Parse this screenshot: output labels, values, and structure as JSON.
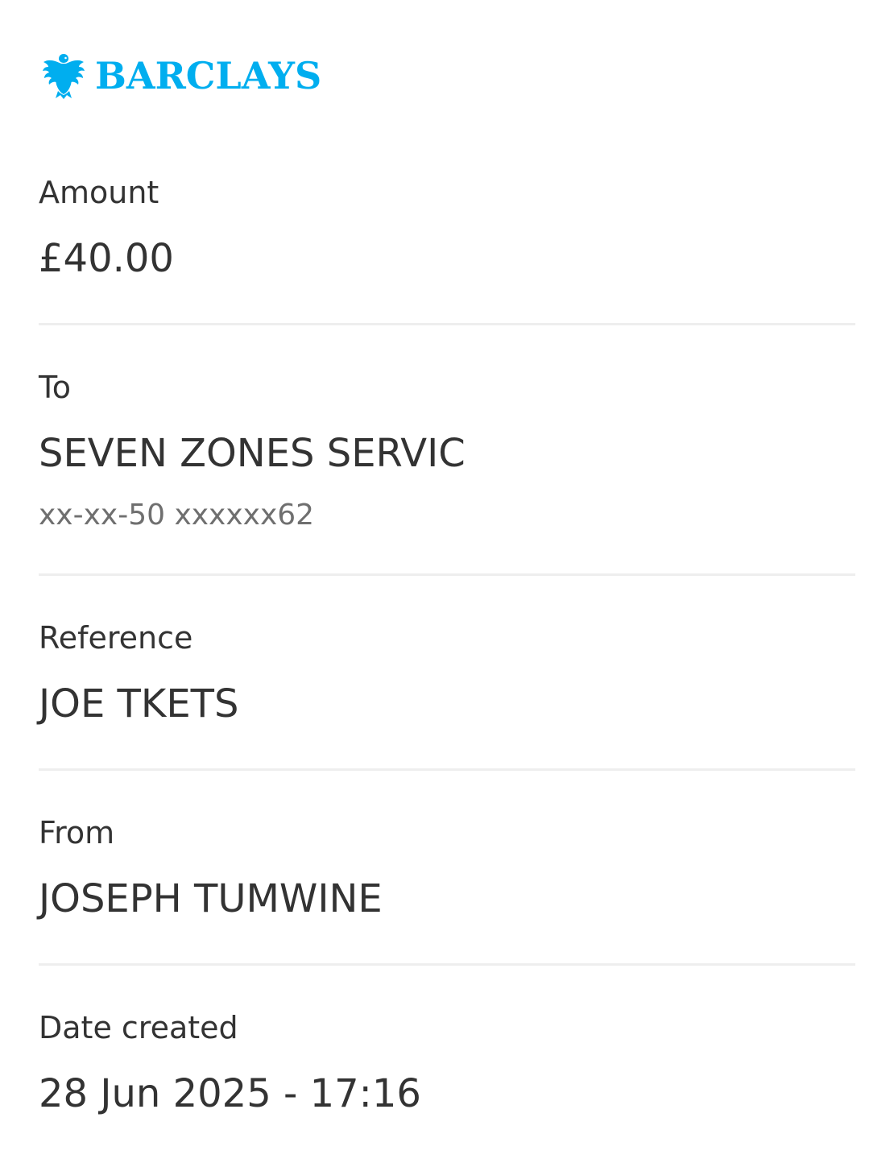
{
  "brand": {
    "name": "BARCLAYS",
    "color": "#00aeef",
    "icon": "eagle-icon"
  },
  "amount": {
    "label": "Amount",
    "value": "£40.00"
  },
  "to": {
    "label": "To",
    "name": "SEVEN ZONES SERVIC",
    "account": "xx-xx-50 xxxxxx62"
  },
  "reference": {
    "label": "Reference",
    "value": "JOE TKETS"
  },
  "from": {
    "label": "From",
    "value": "JOSEPH TUMWINE"
  },
  "date_created": {
    "label": "Date created",
    "value": "28 Jun 2025 - 17:16"
  }
}
